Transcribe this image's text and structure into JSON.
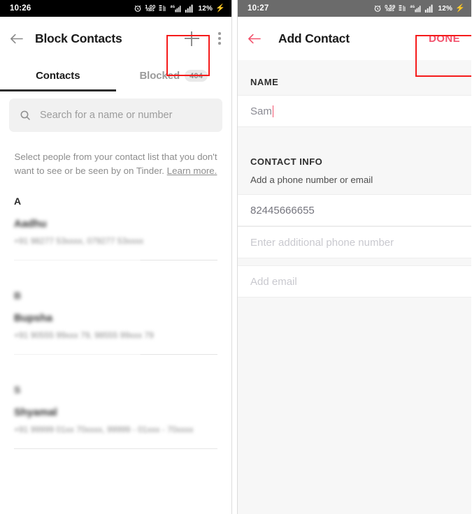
{
  "left_panel": {
    "status_bar": {
      "time": "10:26",
      "alarm_icon": "alarm-icon",
      "net_speed_value": "1.00",
      "net_speed_unit": "KB/S",
      "data_icon": "mobile-data-icon",
      "signal_icon_1": "signal-4g-icon",
      "signal_icon_2": "signal-bars-icon",
      "battery": "12%",
      "charging_icon": "lightning-bolt-icon"
    },
    "appbar": {
      "back_icon": "back-arrow-icon",
      "title": "Block Contacts",
      "add_icon": "plus-icon",
      "overflow_icon": "kebab-menu-icon"
    },
    "tabs": [
      {
        "label": "Contacts",
        "active": true,
        "badge": ""
      },
      {
        "label": "Blocked",
        "active": false,
        "badge": "404"
      }
    ],
    "search": {
      "icon": "search-icon",
      "placeholder": "Search for a name or number"
    },
    "helper": {
      "text": "Select people from your contact list that you don't want to see or be seen by on Tinder. ",
      "link": "Learn more."
    },
    "sections": [
      {
        "letter": "A",
        "letter_blurred": false,
        "contacts": [
          {
            "name": "Aadhu",
            "detail": "+91 98277 53xxxx, 079277 53xxxx"
          }
        ]
      },
      {
        "letter": "B",
        "letter_blurred": true,
        "contacts": [
          {
            "name": "Bupsha",
            "detail": "+91 90555 99xxx 79,  98555 99xxx 79"
          }
        ]
      },
      {
        "letter": "S",
        "letter_blurred": true,
        "contacts": [
          {
            "name": "Shyamal",
            "detail": "+91 99999 01xx 70xxxx,  99999 - 01xxx - 70xxxx"
          }
        ]
      }
    ]
  },
  "right_panel": {
    "status_bar": {
      "time": "10:27",
      "alarm_icon": "alarm-icon",
      "net_speed_value": "0.59",
      "net_speed_unit": "KB/S",
      "data_icon": "mobile-data-icon",
      "signal_icon_1": "signal-4g-icon",
      "signal_icon_2": "signal-bars-icon",
      "battery": "12%",
      "charging_icon": "lightning-bolt-icon"
    },
    "appbar": {
      "back_icon": "back-arrow-icon",
      "title": "Add Contact",
      "done_label": "DONE"
    },
    "form": {
      "name_label": "NAME",
      "name_value": "Sam",
      "contact_info_label": "CONTACT INFO",
      "contact_info_sub": "Add a phone number or email",
      "phone_value": "82445666655",
      "phone_placeholder": "Enter additional phone number",
      "email_placeholder": "Add email"
    }
  },
  "colors": {
    "accent_red": "#f2536d",
    "highlight_box": "#f51b1b",
    "status_dark": "#000000",
    "status_gray": "#6b6b6b",
    "panel_bg": "#f7f7f7"
  }
}
